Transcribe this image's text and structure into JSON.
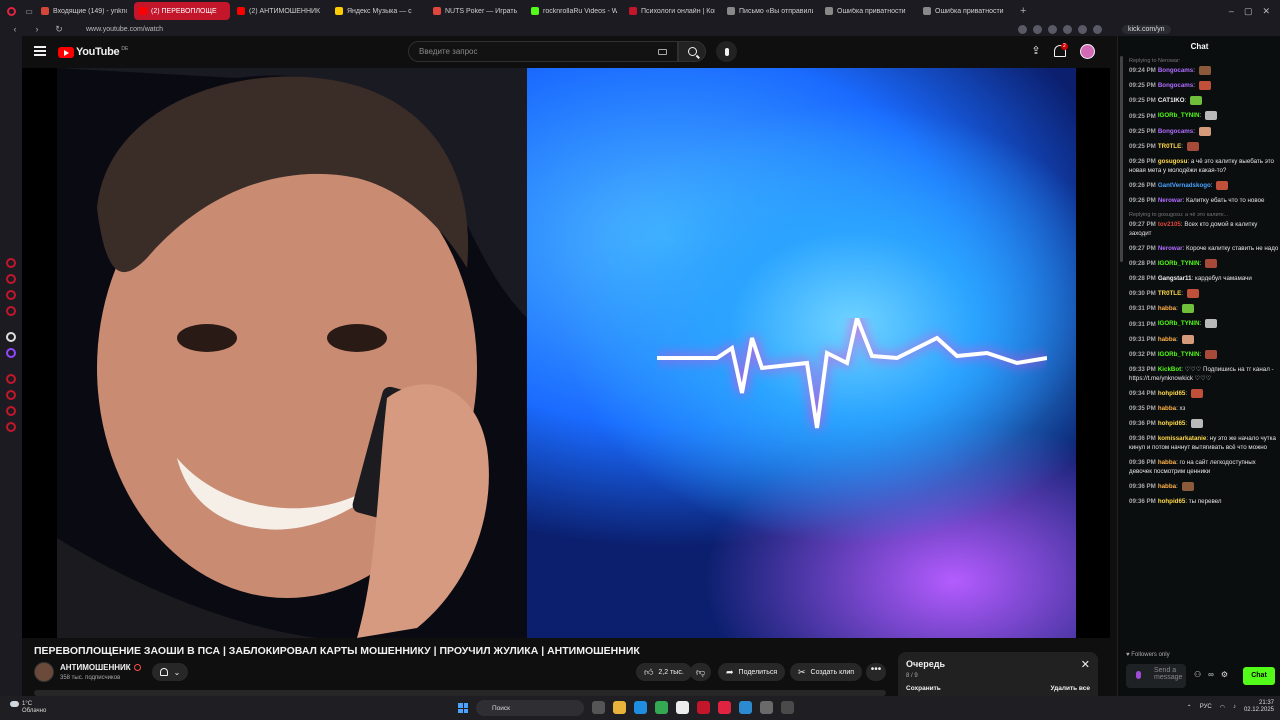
{
  "browser": {
    "tabs": [
      {
        "label": "Входящие (149) - ynkno",
        "color": "#d44638",
        "active": false
      },
      {
        "label": "(2) ПЕРЕВОПЛОЩЕ",
        "color": "#ff0000",
        "active": true
      },
      {
        "label": "(2) АНТИМОШЕННИК",
        "color": "#ff0000",
        "active": false
      },
      {
        "label": "Яндекс Музыка — с",
        "color": "#ffcc00",
        "active": false
      },
      {
        "label": "NUTS Poker — Играть",
        "color": "#e0463b",
        "active": false
      },
      {
        "label": "rocknrollaRu Videos - Wi",
        "color": "#53fc18",
        "active": false
      },
      {
        "label": "Психологи онлайн | Кон",
        "color": "#c4162b",
        "active": false
      },
      {
        "label": "Письмо «Вы отправили",
        "color": "#888888",
        "active": false
      },
      {
        "label": "Ошибка приватности",
        "color": "#888888",
        "active": false
      },
      {
        "label": "Ошибка приватности",
        "color": "#888888",
        "active": false
      }
    ],
    "url": "www.youtube.com/watch",
    "kick_url": "kick.com/yn"
  },
  "youtube": {
    "logo_text": "YouTube",
    "logo_suffix": "DE",
    "search_placeholder": "Введите запрос",
    "notification_count": "2"
  },
  "video": {
    "title": "ПЕРЕВОПЛОЩЕНИЕ ЗАОШИ В ПСА | ЗАБЛОКИРОВАЛ КАРТЫ МОШЕННИКУ | ПРОУЧИЛ ЖУЛИКА | АНТИМОШЕННИК",
    "channel_name": "АНТИМОШЕННИК",
    "subscribers": "358 тыс. подписчиков",
    "likes": "2,2 тыс.",
    "share_label": "Поделиться",
    "clip_label": "Создать клип",
    "more_label": "•••"
  },
  "queue": {
    "title": "Очередь",
    "count": "8 / 9",
    "save_label": "Сохранить",
    "clear_label": "Удалить все"
  },
  "chat": {
    "title": "Chat",
    "followers_only": "Followers only",
    "input_placeholder": "Send a message",
    "send_label": "Chat",
    "messages": [
      {
        "reply": "Replying to Nerowar:",
        "time": "09:24 PM",
        "user": "Bongocams",
        "color": "#b06cff",
        "text": ""
      },
      {
        "reply": "",
        "time": "09:25 PM",
        "user": "Bongocams",
        "color": "#b06cff",
        "text": ""
      },
      {
        "reply": "",
        "time": "09:25 PM",
        "user": "CAT1IKO",
        "color": "#f1f1f1",
        "text": ""
      },
      {
        "reply": "",
        "time": "09:25 PM",
        "user": "IGORb_TYNIN",
        "color": "#53fc18",
        "text": ""
      },
      {
        "reply": "",
        "time": "09:25 PM",
        "user": "Bongocams",
        "color": "#b06cff",
        "text": ""
      },
      {
        "reply": "",
        "time": "09:25 PM",
        "user": "TR0TLE",
        "color": "#ffd84a",
        "text": ""
      },
      {
        "reply": "",
        "time": "09:26 PM",
        "user": "gosugosu",
        "color": "#ffd84a",
        "text": "а чё это калитку выебать это новая мета у молодёжи какая-то?"
      },
      {
        "reply": "",
        "time": "09:26 PM",
        "user": "GantVernadskogo",
        "color": "#4aa3ff",
        "text": ""
      },
      {
        "reply": "",
        "time": "09:26 PM",
        "user": "Nerowar",
        "color": "#b06cff",
        "text": "Калитку ебать что то новое"
      },
      {
        "reply": "Replying to gosugosu: а чё это калитк...",
        "time": "09:27 PM",
        "user": "tov2105",
        "color": "#e0463b",
        "text": "Всех кто домой в калитку заходит"
      },
      {
        "reply": "",
        "time": "09:27 PM",
        "user": "Nerowar",
        "color": "#b06cff",
        "text": "Короче калитку ставить не надо"
      },
      {
        "reply": "",
        "time": "09:28 PM",
        "user": "IGORb_TYNIN",
        "color": "#53fc18",
        "text": ""
      },
      {
        "reply": "",
        "time": "09:28 PM",
        "user": "Gangstar11",
        "color": "#f1f1f1",
        "text": "кардебул чамамачи"
      },
      {
        "reply": "",
        "time": "09:30 PM",
        "user": "TR0TLE",
        "color": "#ffd84a",
        "text": ""
      },
      {
        "reply": "",
        "time": "09:31 PM",
        "user": "habba",
        "color": "#ffb14a",
        "text": ""
      },
      {
        "reply": "",
        "time": "09:31 PM",
        "user": "IGORb_TYNIN",
        "color": "#53fc18",
        "text": ""
      },
      {
        "reply": "",
        "time": "09:31 PM",
        "user": "habba",
        "color": "#ffb14a",
        "text": ""
      },
      {
        "reply": "",
        "time": "09:32 PM",
        "user": "IGORb_TYNIN",
        "color": "#53fc18",
        "text": ""
      },
      {
        "reply": "",
        "time": "09:33 PM",
        "user": "KickBot",
        "color": "#53fc18",
        "text": "♡♡♡ Подпишись на тг канал - https://t.me/ynknowkick ♡♡♡"
      },
      {
        "reply": "",
        "time": "09:34 PM",
        "user": "hohpid65",
        "color": "#ffd84a",
        "text": ""
      },
      {
        "reply": "",
        "time": "09:35 PM",
        "user": "habba",
        "color": "#ffb14a",
        "text": "хз"
      },
      {
        "reply": "",
        "time": "09:36 PM",
        "user": "hohpid65",
        "color": "#ffd84a",
        "text": ""
      },
      {
        "reply": "",
        "time": "09:36 PM",
        "user": "komissarkatanie",
        "color": "#ffd84a",
        "text": "ну это же начало чутка кинул и потом начнут вытягивать всё что можно"
      },
      {
        "reply": "",
        "time": "09:36 PM",
        "user": "habba",
        "color": "#ffb14a",
        "text": "го на сайт легкодоступных девочек посмотрим ценники"
      },
      {
        "reply": "",
        "time": "09:36 PM",
        "user": "habba",
        "color": "#ffb14a",
        "text": ""
      },
      {
        "reply": "",
        "time": "09:36 PM",
        "user": "hohpid65",
        "color": "#ffd84a",
        "text": "ты перевел"
      }
    ]
  },
  "taskbar": {
    "temperature": "1°C",
    "weather": "Облачно",
    "search_label": "Поиск",
    "lang": "РУС",
    "time": "21:37",
    "date": "02.12.2025"
  }
}
